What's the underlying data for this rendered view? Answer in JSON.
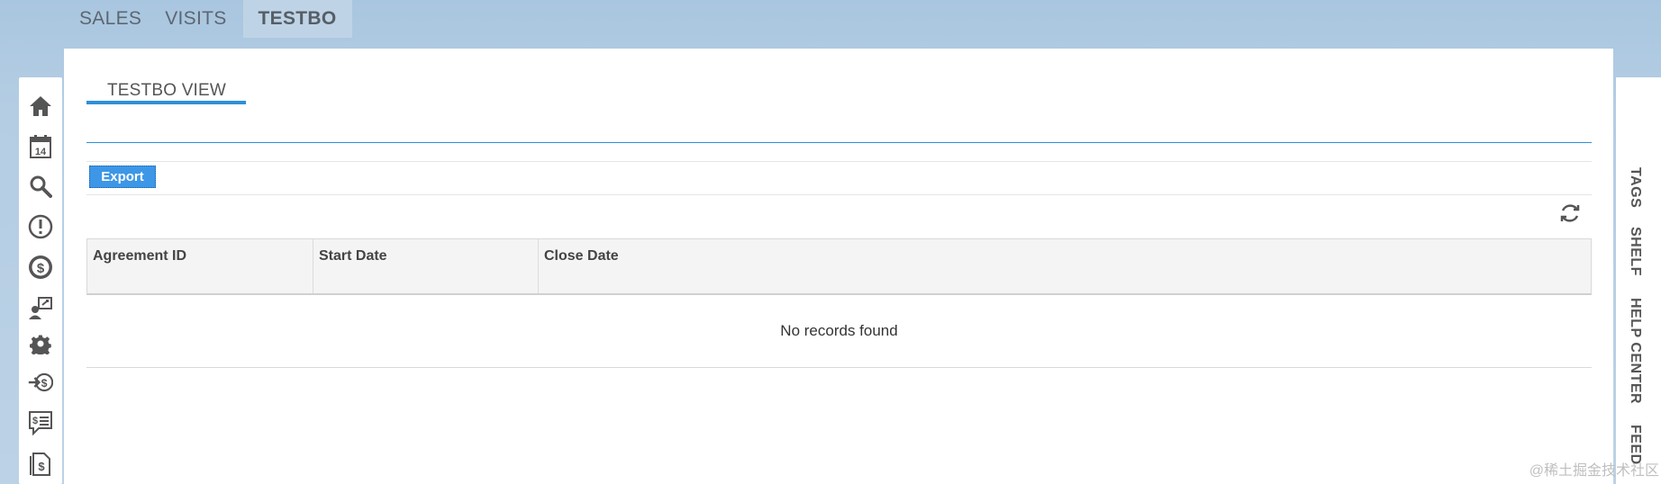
{
  "top_nav": {
    "tabs": [
      {
        "label": "SALES"
      },
      {
        "label": "VISITS"
      },
      {
        "label": "TESTBO"
      }
    ]
  },
  "sidebar": {
    "icons": [
      "home-icon",
      "calendar-icon",
      "search-icon",
      "alert-icon",
      "dollar-coin-icon",
      "user-exchange-icon",
      "gear-icon",
      "dollar-arrow-icon",
      "dollar-chat-icon",
      "dollar-document-icon"
    ],
    "calendar_day": "14"
  },
  "view": {
    "tab_label": "TESTBO VIEW"
  },
  "toolbar": {
    "export_label": "Export"
  },
  "grid": {
    "columns": [
      "Agreement ID",
      "Start Date",
      "Close Date"
    ],
    "empty_message": "No records found"
  },
  "right_sidebar": {
    "items": [
      "TAGS",
      "SHELF",
      "HELP CENTER",
      "FEED"
    ]
  },
  "watermark": "@稀土掘金技术社区",
  "colors": {
    "accent": "#2f8fd8",
    "button": "#3d97e6",
    "background": "#b4cde3"
  }
}
